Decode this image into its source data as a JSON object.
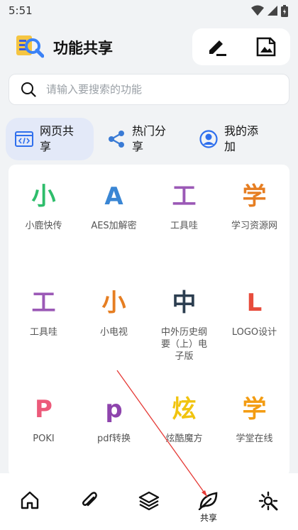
{
  "status": {
    "time": "5:51"
  },
  "header": {
    "title": "功能共享"
  },
  "search": {
    "placeholder": "请输入要搜索的功能"
  },
  "tabs": [
    {
      "label": "网页共享",
      "icon": "web-code-icon",
      "active": true
    },
    {
      "label": "热门分享",
      "icon": "share-icon",
      "active": false
    },
    {
      "label": "我的添加",
      "icon": "user-icon",
      "active": false
    }
  ],
  "grid": {
    "items": [
      {
        "char": "小",
        "color": "#2ebd6b",
        "label": "小鹿快传"
      },
      {
        "char": "A",
        "color": "#3a86d4",
        "label": "AES加解密"
      },
      {
        "char": "工",
        "color": "#9b59b6",
        "label": "工具哇"
      },
      {
        "char": "学",
        "color": "#e67e22",
        "label": "学习资源网"
      },
      {
        "char": "工",
        "color": "#9b59b6",
        "label": "工具哇"
      },
      {
        "char": "小",
        "color": "#e67e22",
        "label": "小电视"
      },
      {
        "char": "中",
        "color": "#2c3e50",
        "label": "中外历史纲要（上）电子版"
      },
      {
        "char": "L",
        "color": "#e74c3c",
        "label": "LOGO设计"
      },
      {
        "char": "P",
        "color": "#ec5a7a",
        "label": "POKI"
      },
      {
        "char": "p",
        "color": "#8e44ad",
        "label": "pdf转换"
      },
      {
        "char": "炫",
        "color": "#f1c40f",
        "label": "炫酷魔方"
      },
      {
        "char": "学",
        "color": "#f39c12",
        "label": "学堂在线"
      }
    ]
  },
  "bottom_nav": {
    "share_label": "共享"
  },
  "colors": {
    "accent": "#3a86d4",
    "active_tab_bg": "#e3e9f8",
    "annotation": "#e53935"
  }
}
